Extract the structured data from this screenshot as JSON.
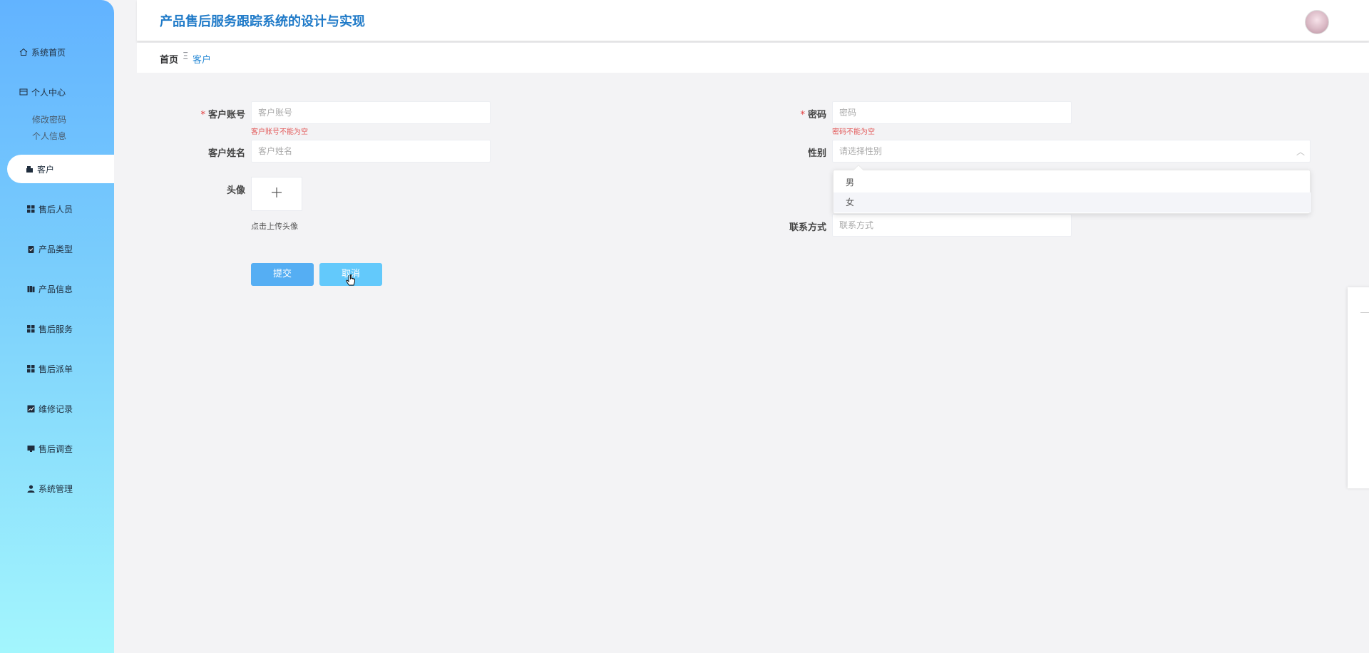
{
  "app": {
    "title": "产品售后服务跟踪系统的设计与实现"
  },
  "sidebar": {
    "items": [
      {
        "label": "系统首页",
        "icon": "home-icon"
      },
      {
        "label": "个人中心",
        "icon": "profile-icon"
      },
      {
        "label": "修改密码"
      },
      {
        "label": "个人信息"
      },
      {
        "label": "客户",
        "icon": "customer-icon",
        "active": true
      },
      {
        "label": "售后人员",
        "icon": "grid-icon"
      },
      {
        "label": "产品类型",
        "icon": "clipboard-icon"
      },
      {
        "label": "产品信息",
        "icon": "book-icon"
      },
      {
        "label": "售后服务",
        "icon": "grid-icon"
      },
      {
        "label": "售后派单",
        "icon": "grid-icon"
      },
      {
        "label": "维修记录",
        "icon": "chart-icon"
      },
      {
        "label": "售后调查",
        "icon": "monitor-icon"
      },
      {
        "label": "系统管理",
        "icon": "user-icon"
      }
    ]
  },
  "breadcrumb": {
    "home": "首页",
    "separator": "Ξ",
    "current": "客户"
  },
  "form": {
    "account_label": "客户账号",
    "account_placeholder": "客户账号",
    "account_error": "客户账号不能为空",
    "password_label": "密码",
    "password_placeholder": "密码",
    "password_error": "密码不能为空",
    "name_label": "客户姓名",
    "name_placeholder": "客户姓名",
    "gender_label": "性别",
    "gender_placeholder": "请选择性别",
    "gender_options": [
      "男",
      "女"
    ],
    "avatar_label": "头像",
    "avatar_hint": "点击上传头像",
    "phone_label": "联系方式",
    "phone_placeholder": "联系方式",
    "submit_label": "提交",
    "cancel_label": "取消"
  },
  "colors": {
    "accent": "#1f7ac8",
    "submit": "#55aef3",
    "cancel": "#63c9fb",
    "error": "#e35b5b"
  }
}
